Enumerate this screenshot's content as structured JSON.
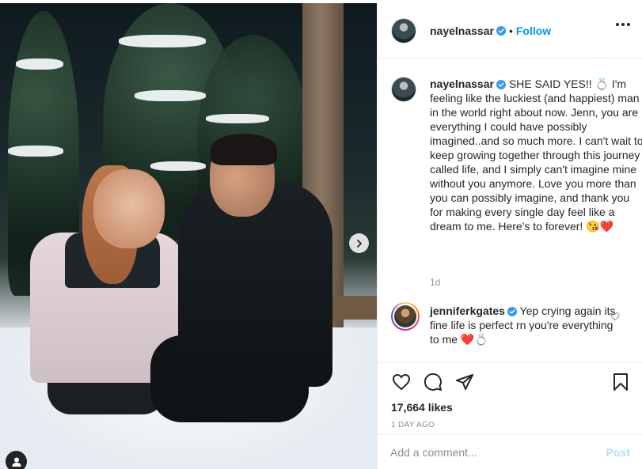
{
  "post": {
    "author": "nayelnassar",
    "follow_label": "Follow",
    "separator": "•",
    "caption_text": "SHE SAID YES!! 💍 I'm feeling like the luckiest (and happiest) man in the world right about now. Jenn, you are everything I could have possibly imagined..and so much more. I can't wait to keep growing together through this journey called life, and I simply can't imagine mine without you anymore. Love you more than you can possibly imagine, and thank you for making every single day feel like a dream to me. Here's to forever! 😘❤️",
    "caption_time": "1d",
    "likes": "17,664 likes",
    "date": "1 DAY AGO"
  },
  "comment": {
    "author": "jenniferkgates",
    "text": "Yep crying again its fine life is perfect rn you're everything to me ❤️💍"
  },
  "add_comment": {
    "placeholder": "Add a comment...",
    "post_label": "Post"
  },
  "icons": {
    "verified": "verified-badge-icon",
    "more": "more-options-icon",
    "like": "heart-icon",
    "comment": "comment-icon",
    "share": "paper-plane-icon",
    "save": "bookmark-icon",
    "next": "chevron-right-icon",
    "tags": "user-tag-icon"
  },
  "colors": {
    "link_blue": "#0095f6",
    "post_disabled": "#b2dffc",
    "muted": "#8e8e8e",
    "text": "#262626"
  }
}
